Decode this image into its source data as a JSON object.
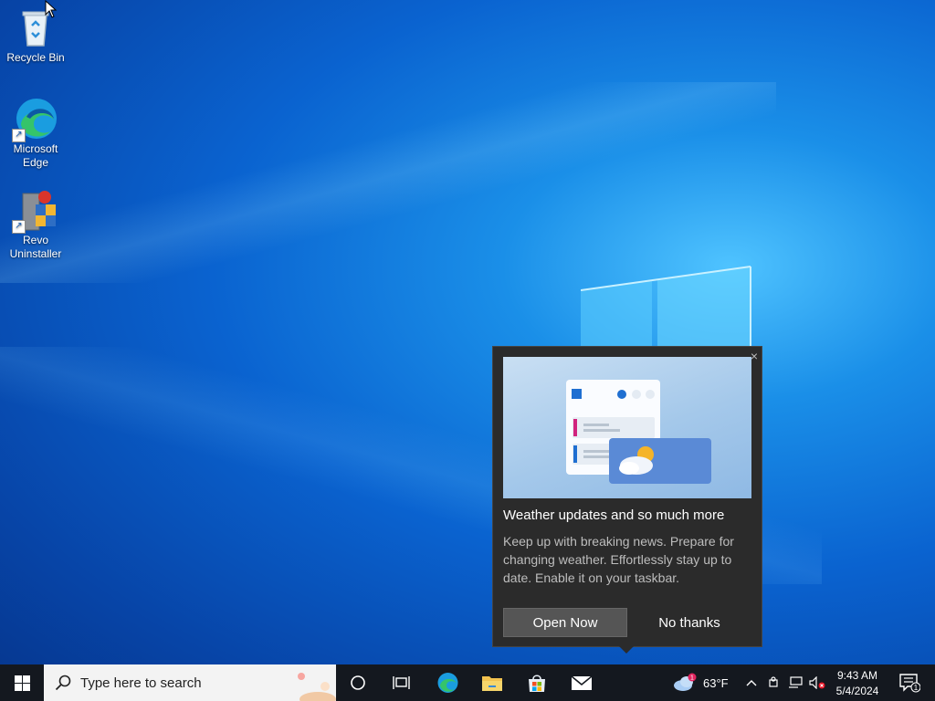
{
  "desktop": {
    "icons": [
      {
        "label": "Recycle Bin",
        "icon": "recycle-bin-icon"
      },
      {
        "label": "Microsoft Edge",
        "line1": "Microsoft",
        "line2": "Edge",
        "icon": "edge-icon"
      },
      {
        "label": "Revo Uninstaller",
        "line1": "Revo",
        "line2": "Uninstaller",
        "icon": "revo-uninstaller-icon"
      }
    ]
  },
  "popup": {
    "close_glyph": "×",
    "title": "Weather updates and so much more",
    "body": "Keep up with breaking news. Prepare for changing weather. Effortlessly stay up to date. Enable it on your taskbar.",
    "primary_button": "Open Now",
    "secondary_button": "No thanks"
  },
  "taskbar": {
    "search_placeholder": "Type here to search",
    "weather_temp": "63°F",
    "weather_badge": "1",
    "time": "9:43 AM",
    "date": "5/4/2024",
    "notification_count": "1"
  },
  "colors": {
    "taskbar_bg": "#14181f",
    "popup_bg": "#2b2b2b",
    "accent": "#0a63d0"
  }
}
